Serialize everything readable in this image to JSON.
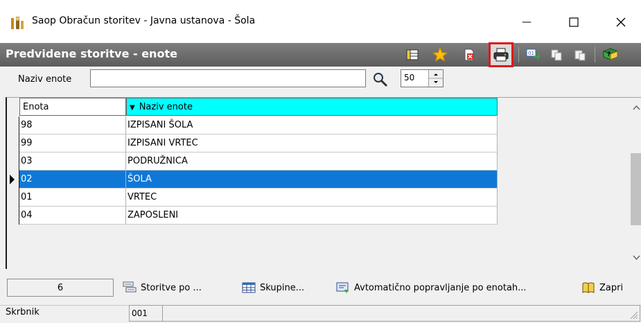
{
  "window": {
    "title": "Saop Obračun storitev - Javna ustanova - Šola",
    "minimize": "—",
    "maximize": "☐",
    "close": "✕"
  },
  "header": {
    "title": "Predvidene storitve - enote"
  },
  "filter": {
    "label": "Naziv enote",
    "value": "",
    "limit": "50"
  },
  "grid": {
    "columns": [
      "Enota",
      "Naziv enote"
    ],
    "sort_indicator": "▼",
    "rows": [
      {
        "enota": "98",
        "naziv": "IZPISANI ŠOLA"
      },
      {
        "enota": "99",
        "naziv": "IZPISANI VRTEC"
      },
      {
        "enota": "03",
        "naziv": "PODRUŽNICA"
      },
      {
        "enota": "02",
        "naziv": "ŠOLA"
      },
      {
        "enota": "01",
        "naziv": "VRTEC"
      },
      {
        "enota": "04",
        "naziv": "ZAPOSLENI"
      }
    ],
    "selected_index": 3
  },
  "footer": {
    "count": "6",
    "btn_storitve": "Storitve po ...",
    "btn_skupine": "Skupine...",
    "btn_avtomaticno": "Avtomatično popravljanje po enotah...",
    "btn_zapri": "Zapri"
  },
  "status": {
    "label": "Skrbnik",
    "value": "001"
  }
}
